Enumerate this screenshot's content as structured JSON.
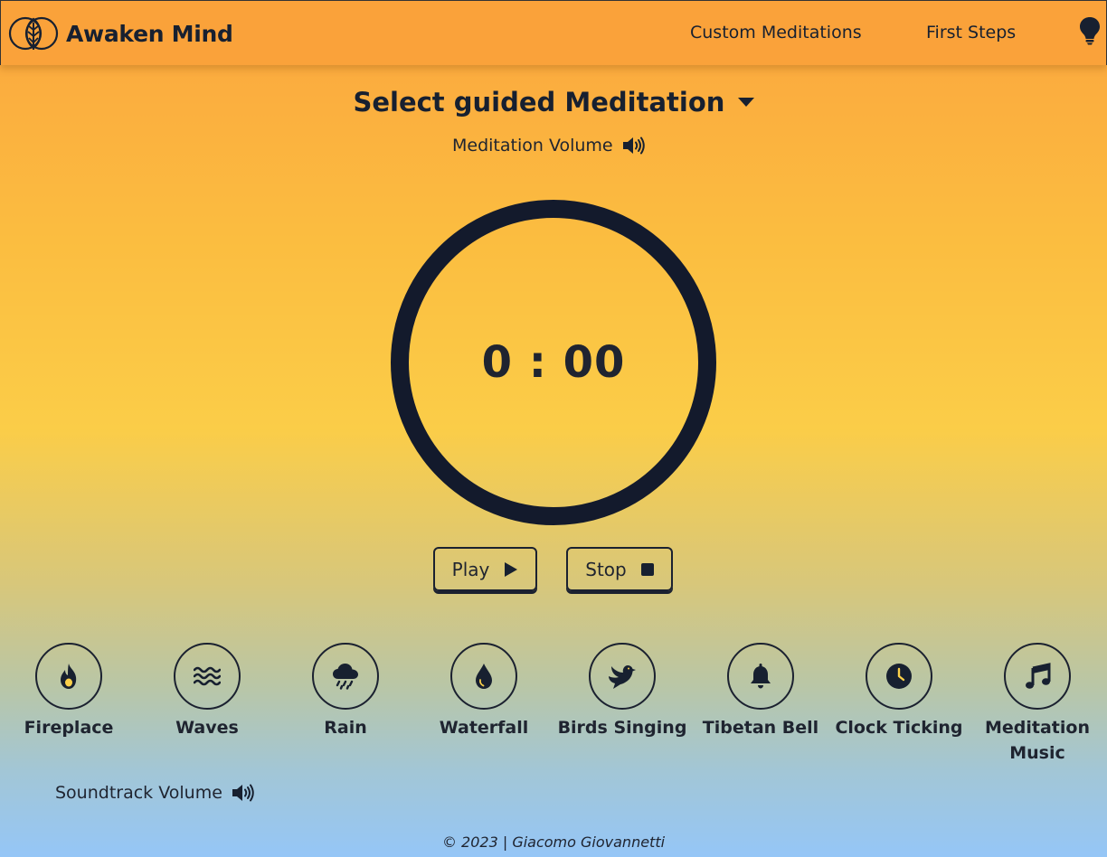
{
  "nav": {
    "brand": "Awaken Mind",
    "links": [
      "Custom Meditations",
      "First Steps"
    ],
    "theme_icon": "lightbulb-icon"
  },
  "meditation": {
    "select_label": "Select guided Meditation",
    "volume_label": "Meditation Volume",
    "timer": "0 : 00"
  },
  "controls": {
    "play": "Play",
    "stop": "Stop"
  },
  "sounds": [
    {
      "label": "Fireplace",
      "icon": "fire-icon"
    },
    {
      "label": "Waves",
      "icon": "water-waves-icon"
    },
    {
      "label": "Rain",
      "icon": "cloud-rain-icon"
    },
    {
      "label": "Waterfall",
      "icon": "droplet-icon"
    },
    {
      "label": "Birds Singing",
      "icon": "dove-icon"
    },
    {
      "label": "Tibetan Bell",
      "icon": "bell-icon"
    },
    {
      "label": "Clock Ticking",
      "icon": "clock-icon"
    },
    {
      "label": "Meditation Music",
      "icon": "music-note-icon"
    }
  ],
  "soundtrack": {
    "volume_label": "Soundtrack Volume"
  },
  "footer": "© 2023 | Giacomo Giovannetti",
  "colors": {
    "dark": "#131a2c",
    "nav_bg": "#faa23a",
    "gradient_top": "#fba53e",
    "gradient_bottom": "#95c6f7"
  }
}
